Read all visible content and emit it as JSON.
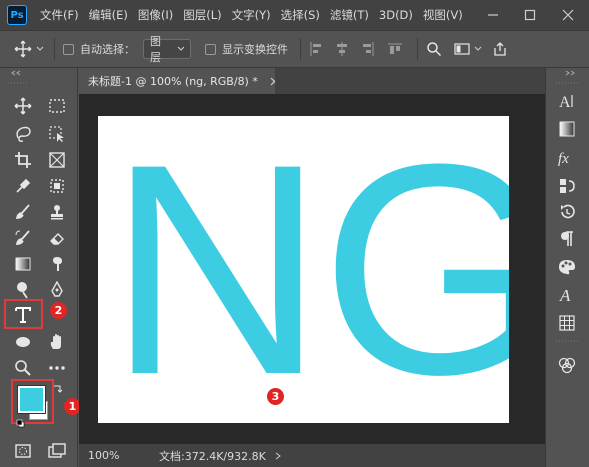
{
  "app": {
    "logo_text": "Ps"
  },
  "menu": {
    "items": [
      "文件(F)",
      "编辑(E)",
      "图像(I)",
      "图层(L)",
      "文字(Y)",
      "选择(S)",
      "滤镜(T)",
      "3D(D)",
      "视图(V)"
    ]
  },
  "options": {
    "auto_select_label": "自动选择：",
    "auto_select_value": "图层",
    "show_transform_label": "显示变换控件"
  },
  "document": {
    "tab_title": "未标题-1 @ 100% (ng, RGB/8) *",
    "text_layer": "NG",
    "text_color": "#3ccde3"
  },
  "status": {
    "zoom": "100%",
    "doc_size": "文档:372.4K/932.8K"
  },
  "swatches": {
    "foreground": "#3ccde3",
    "background": "#ffffff"
  },
  "annotations": {
    "m1": "1",
    "m2": "2",
    "m3": "3",
    "color": "#e02525"
  }
}
